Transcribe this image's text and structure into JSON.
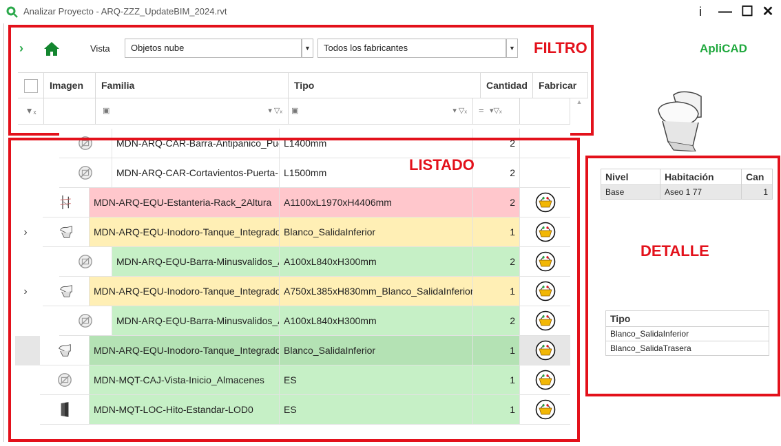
{
  "window": {
    "title": "Analizar Proyecto - ARQ-ZZZ_UpdateBIM_2024.rvt",
    "info_label": "i",
    "minimize_label": "—",
    "maximize_label": "☐",
    "close_label": "✕"
  },
  "toolbar": {
    "expand_label": "›",
    "vista_label": "Vista",
    "vista_value": "Objetos nube",
    "fabricante_value": "Todos los fabricantes"
  },
  "annotations": {
    "filtro": "FILTRO",
    "listado": "LISTADO",
    "detalle": "DETALLE"
  },
  "brand": "ApliCAD",
  "grid": {
    "headers": [
      "Imagen",
      "Familia",
      "Tipo",
      "Cantidad",
      "Fabricar"
    ],
    "filter_operator": "="
  },
  "rows": [
    {
      "familia": "MDN-ARQ-CAR-Barra-Antipanico_Puerta",
      "tipo": "L1400mm",
      "cantidad": "2",
      "color": "#ffffff",
      "indent": 2,
      "expand": "",
      "fabricar": false,
      "thumb": "no-image-icon"
    },
    {
      "familia": "MDN-ARQ-CAR-Cortavientos-Puerta-L",
      "tipo": "L1500mm",
      "cantidad": "2",
      "color": "#ffffff",
      "indent": 2,
      "expand": "",
      "fabricar": false,
      "thumb": "no-image-icon"
    },
    {
      "familia": "MDN-ARQ-EQU-Estanteria-Rack_2Altura",
      "tipo": "A1100xL1970xH4406mm",
      "cantidad": "2",
      "color": "#ffc7cc",
      "indent": 1,
      "expand": "",
      "fabricar": true,
      "thumb": "rack-icon"
    },
    {
      "familia": "MDN-ARQ-EQU-Inodoro-Tanque_Integrado",
      "tipo": "Blanco_SalidaInferior",
      "cantidad": "1",
      "color": "#ffefb5",
      "indent": 1,
      "expand": "›",
      "fabricar": true,
      "thumb": "toilet-icon"
    },
    {
      "familia": "MDN-ARQ-EQU-Barra-Minusvalidos_A",
      "tipo": "A100xL840xH300mm",
      "cantidad": "2",
      "color": "#c6f0c6",
      "indent": 2,
      "expand": "",
      "fabricar": true,
      "thumb": "no-image-icon"
    },
    {
      "familia": "MDN-ARQ-EQU-Inodoro-Tanque_Integrado",
      "tipo": "A750xL385xH830mm_Blanco_SalidaInferior",
      "cantidad": "1",
      "color": "#ffefb5",
      "indent": 1,
      "expand": "›",
      "fabricar": true,
      "thumb": "toilet-icon"
    },
    {
      "familia": "MDN-ARQ-EQU-Barra-Minusvalidos_A",
      "tipo": "A100xL840xH300mm",
      "cantidad": "2",
      "color": "#c6f0c6",
      "indent": 2,
      "expand": "",
      "fabricar": true,
      "thumb": "no-image-icon"
    },
    {
      "familia": "MDN-ARQ-EQU-Inodoro-Tanque_Integrado",
      "tipo": "Blanco_SalidaInferior",
      "cantidad": "1",
      "color": "#b4e2b4",
      "indent": 0,
      "expand": "",
      "fabricar": true,
      "thumb": "toilet-icon",
      "selected": true
    },
    {
      "familia": "MDN-MQT-CAJ-Vista-Inicio_Almacenes",
      "tipo": "ES",
      "cantidad": "1",
      "color": "#c6f0c6",
      "indent": 0,
      "expand": "",
      "fabricar": true,
      "thumb": "no-image-icon"
    },
    {
      "familia": "MDN-MQT-LOC-Hito-Estandar-LOD0",
      "tipo": "ES",
      "cantidad": "1",
      "color": "#c6f0c6",
      "indent": 0,
      "expand": "",
      "fabricar": true,
      "thumb": "marker-icon"
    }
  ],
  "detail": {
    "niveles": {
      "headers": [
        "Nivel",
        "Habitación",
        "Can"
      ],
      "rows": [
        [
          "Base",
          "Aseo 1 77",
          "1"
        ]
      ]
    },
    "tipos": {
      "header": "Tipo",
      "rows": [
        "Blanco_SalidaInferior",
        "Blanco_SalidaTrasera"
      ]
    }
  }
}
